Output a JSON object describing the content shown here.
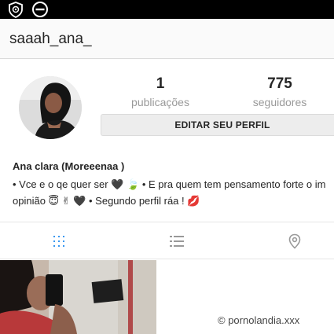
{
  "status_bar": {
    "icons": [
      "shield-icon",
      "do-not-disturb-icon"
    ]
  },
  "header": {
    "username": "saaah_ana_"
  },
  "profile": {
    "avatar_icon": "profile-photo",
    "stats": {
      "posts": {
        "value": "1",
        "label": "publicações"
      },
      "followers": {
        "value": "775",
        "label": "seguidores"
      }
    },
    "edit_button_label": "EDITAR SEU PERFIL",
    "full_name": "Ana clara (Moreeenaa )",
    "bio_lines": [
      "• Vce e o qe quer ser 🖤 🍃 • E pra quem tem pensamento forte o im",
      "opinião 😇 ✌ 🖤 • Segundo perfil ráa ! 💋"
    ]
  },
  "tabs": [
    {
      "name": "grid",
      "icon": "grid-icon",
      "active": true
    },
    {
      "name": "list",
      "icon": "list-icon",
      "active": false
    },
    {
      "name": "location",
      "icon": "location-pin-icon",
      "active": false
    }
  ],
  "watermark": "© pornolandia.xxx",
  "colors": {
    "status_bar": "#000000",
    "header_bg": "#fafafa",
    "text": "#262626",
    "muted": "#999999",
    "active_tab": "#3897f0",
    "inactive_tab": "#999999"
  }
}
